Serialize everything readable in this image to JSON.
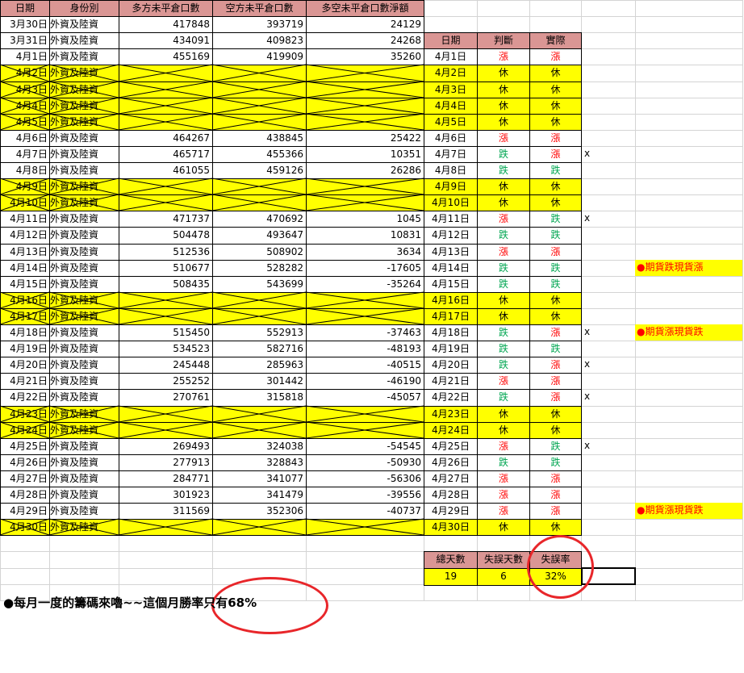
{
  "main_table": {
    "headers": [
      "日期",
      "身份別",
      "多方未平倉口數",
      "空方未平倉口數",
      "多空未平倉口數淨額"
    ],
    "rows": [
      {
        "date": "3月30日",
        "identity": "外資及陸資",
        "long": "417848",
        "short": "393719",
        "net": "24129",
        "holiday": false
      },
      {
        "date": "3月31日",
        "identity": "外資及陸資",
        "long": "434091",
        "short": "409823",
        "net": "24268",
        "holiday": false
      },
      {
        "date": "4月1日",
        "identity": "外資及陸資",
        "long": "455169",
        "short": "419909",
        "net": "35260",
        "holiday": false
      },
      {
        "date": "4月2日",
        "identity": "外資及陸資",
        "long": "",
        "short": "",
        "net": "",
        "holiday": true
      },
      {
        "date": "4月3日",
        "identity": "外資及陸資",
        "long": "",
        "short": "",
        "net": "",
        "holiday": true
      },
      {
        "date": "4月4日",
        "identity": "外資及陸資",
        "long": "",
        "short": "",
        "net": "",
        "holiday": true
      },
      {
        "date": "4月5日",
        "identity": "外資及陸資",
        "long": "",
        "short": "",
        "net": "",
        "holiday": true
      },
      {
        "date": "4月6日",
        "identity": "外資及陸資",
        "long": "464267",
        "short": "438845",
        "net": "25422",
        "holiday": false
      },
      {
        "date": "4月7日",
        "identity": "外資及陸資",
        "long": "465717",
        "short": "455366",
        "net": "10351",
        "holiday": false
      },
      {
        "date": "4月8日",
        "identity": "外資及陸資",
        "long": "461055",
        "short": "459126",
        "net": "26286",
        "holiday": false
      },
      {
        "date": "4月9日",
        "identity": "外資及陸資",
        "long": "",
        "short": "",
        "net": "",
        "holiday": true
      },
      {
        "date": "4月10日",
        "identity": "外資及陸資",
        "long": "",
        "short": "",
        "net": "",
        "holiday": true
      },
      {
        "date": "4月11日",
        "identity": "外資及陸資",
        "long": "471737",
        "short": "470692",
        "net": "1045",
        "holiday": false
      },
      {
        "date": "4月12日",
        "identity": "外資及陸資",
        "long": "504478",
        "short": "493647",
        "net": "10831",
        "holiday": false
      },
      {
        "date": "4月13日",
        "identity": "外資及陸資",
        "long": "512536",
        "short": "508902",
        "net": "3634",
        "holiday": false
      },
      {
        "date": "4月14日",
        "identity": "外資及陸資",
        "long": "510677",
        "short": "528282",
        "net": "-17605",
        "holiday": false
      },
      {
        "date": "4月15日",
        "identity": "外資及陸資",
        "long": "508435",
        "short": "543699",
        "net": "-35264",
        "holiday": false
      },
      {
        "date": "4月16日",
        "identity": "外資及陸資",
        "long": "",
        "short": "",
        "net": "",
        "holiday": true
      },
      {
        "date": "4月17日",
        "identity": "外資及陸資",
        "long": "",
        "short": "",
        "net": "",
        "holiday": true
      },
      {
        "date": "4月18日",
        "identity": "外資及陸資",
        "long": "515450",
        "short": "552913",
        "net": "-37463",
        "holiday": false
      },
      {
        "date": "4月19日",
        "identity": "外資及陸資",
        "long": "534523",
        "short": "582716",
        "net": "-48193",
        "holiday": false
      },
      {
        "date": "4月20日",
        "identity": "外資及陸資",
        "long": "245448",
        "short": "285963",
        "net": "-40515",
        "holiday": false
      },
      {
        "date": "4月21日",
        "identity": "外資及陸資",
        "long": "255252",
        "short": "301442",
        "net": "-46190",
        "holiday": false
      },
      {
        "date": "4月22日",
        "identity": "外資及陸資",
        "long": "270761",
        "short": "315818",
        "net": "-45057",
        "holiday": false
      },
      {
        "date": "4月23日",
        "identity": "外資及陸資",
        "long": "",
        "short": "",
        "net": "",
        "holiday": true
      },
      {
        "date": "4月24日",
        "identity": "外資及陸資",
        "long": "",
        "short": "",
        "net": "",
        "holiday": true
      },
      {
        "date": "4月25日",
        "identity": "外資及陸資",
        "long": "269493",
        "short": "324038",
        "net": "-54545",
        "holiday": false
      },
      {
        "date": "4月26日",
        "identity": "外資及陸資",
        "long": "277913",
        "short": "328843",
        "net": "-50930",
        "holiday": false
      },
      {
        "date": "4月27日",
        "identity": "外資及陸資",
        "long": "284771",
        "short": "341077",
        "net": "-56306",
        "holiday": false
      },
      {
        "date": "4月28日",
        "identity": "外資及陸資",
        "long": "301923",
        "short": "341479",
        "net": "-39556",
        "holiday": false
      },
      {
        "date": "4月29日",
        "identity": "外資及陸資",
        "long": "311569",
        "short": "352306",
        "net": "-40737",
        "holiday": false
      },
      {
        "date": "4月30日",
        "identity": "外資及陸資",
        "long": "",
        "short": "",
        "net": "",
        "holiday": true
      }
    ]
  },
  "judge_table": {
    "headers": [
      "日期",
      "判斷",
      "實際"
    ],
    "rows": [
      {
        "date": "4月1日",
        "judge": "漲",
        "actual": "漲",
        "holiday": false,
        "miss": ""
      },
      {
        "date": "4月2日",
        "judge": "休",
        "actual": "休",
        "holiday": true,
        "miss": ""
      },
      {
        "date": "4月3日",
        "judge": "休",
        "actual": "休",
        "holiday": true,
        "miss": ""
      },
      {
        "date": "4月4日",
        "judge": "休",
        "actual": "休",
        "holiday": true,
        "miss": ""
      },
      {
        "date": "4月5日",
        "judge": "休",
        "actual": "休",
        "holiday": true,
        "miss": ""
      },
      {
        "date": "4月6日",
        "judge": "漲",
        "actual": "漲",
        "holiday": false,
        "miss": ""
      },
      {
        "date": "4月7日",
        "judge": "跌",
        "actual": "漲",
        "holiday": false,
        "miss": "x"
      },
      {
        "date": "4月8日",
        "judge": "跌",
        "actual": "跌",
        "holiday": false,
        "miss": ""
      },
      {
        "date": "4月9日",
        "judge": "休",
        "actual": "休",
        "holiday": true,
        "miss": ""
      },
      {
        "date": "4月10日",
        "judge": "休",
        "actual": "休",
        "holiday": true,
        "miss": ""
      },
      {
        "date": "4月11日",
        "judge": "漲",
        "actual": "跌",
        "holiday": false,
        "miss": "x"
      },
      {
        "date": "4月12日",
        "judge": "跌",
        "actual": "跌",
        "holiday": false,
        "miss": ""
      },
      {
        "date": "4月13日",
        "judge": "漲",
        "actual": "漲",
        "holiday": false,
        "miss": ""
      },
      {
        "date": "4月14日",
        "judge": "跌",
        "actual": "跌",
        "holiday": false,
        "miss": ""
      },
      {
        "date": "4月15日",
        "judge": "跌",
        "actual": "跌",
        "holiday": false,
        "miss": ""
      },
      {
        "date": "4月16日",
        "judge": "休",
        "actual": "休",
        "holiday": true,
        "miss": ""
      },
      {
        "date": "4月17日",
        "judge": "休",
        "actual": "休",
        "holiday": true,
        "miss": ""
      },
      {
        "date": "4月18日",
        "judge": "跌",
        "actual": "漲",
        "holiday": false,
        "miss": "x"
      },
      {
        "date": "4月19日",
        "judge": "跌",
        "actual": "跌",
        "holiday": false,
        "miss": ""
      },
      {
        "date": "4月20日",
        "judge": "跌",
        "actual": "漲",
        "holiday": false,
        "miss": "x"
      },
      {
        "date": "4月21日",
        "judge": "漲",
        "actual": "漲",
        "holiday": false,
        "miss": ""
      },
      {
        "date": "4月22日",
        "judge": "跌",
        "actual": "漲",
        "holiday": false,
        "miss": "x"
      },
      {
        "date": "4月23日",
        "judge": "休",
        "actual": "休",
        "holiday": true,
        "miss": ""
      },
      {
        "date": "4月24日",
        "judge": "休",
        "actual": "休",
        "holiday": true,
        "miss": ""
      },
      {
        "date": "4月25日",
        "judge": "漲",
        "actual": "跌",
        "holiday": false,
        "miss": "x"
      },
      {
        "date": "4月26日",
        "judge": "跌",
        "actual": "跌",
        "holiday": false,
        "miss": ""
      },
      {
        "date": "4月27日",
        "judge": "漲",
        "actual": "漲",
        "holiday": false,
        "miss": ""
      },
      {
        "date": "4月28日",
        "judge": "漲",
        "actual": "漲",
        "holiday": false,
        "miss": ""
      },
      {
        "date": "4月29日",
        "judge": "漲",
        "actual": "漲",
        "holiday": false,
        "miss": ""
      },
      {
        "date": "4月30日",
        "judge": "休",
        "actual": "休",
        "holiday": true,
        "miss": ""
      }
    ]
  },
  "notes": [
    {
      "date": "4月14日",
      "text": "●期貨跌現貨漲"
    },
    {
      "date": "4月18日",
      "text": "●期貨漲現貨跌"
    },
    {
      "date": "4月29日",
      "text": "●期貨漲現貨跌"
    }
  ],
  "summary": {
    "headers": [
      "總天數",
      "失誤天數",
      "失誤率"
    ],
    "values": [
      "19",
      "6",
      "32%"
    ]
  },
  "footer": "●每月一度的籌碼來嚕~~這個月勝率只有68%",
  "colors": {
    "header_bg": "#da9694",
    "holiday_bg": "#ffff00",
    "up_text": "#ff0000",
    "down_text": "#00a651",
    "circle": "#e8262a"
  }
}
